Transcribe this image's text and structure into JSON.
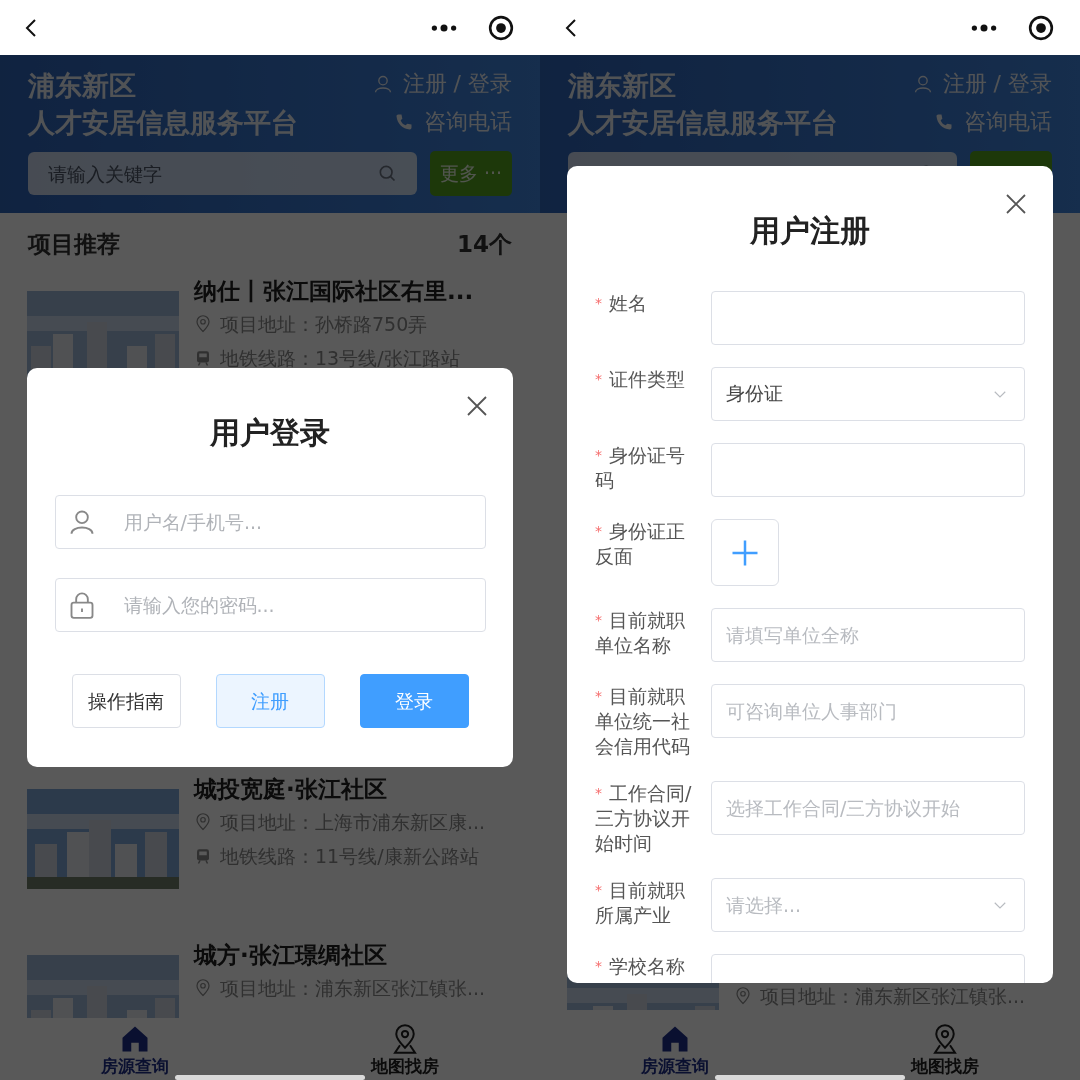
{
  "screens": [
    {
      "header": {
        "title": [
          "浦东新区",
          "人才安居信息服务平台"
        ],
        "account_link": "注册 / 登录",
        "hotline_link": "咨询电话",
        "search": {
          "placeholder": "请输入关键字"
        },
        "more_button": "更多 ···"
      },
      "section": {
        "title": "项目推荐",
        "count": "14个"
      },
      "projects": [
        {
          "title": "纳仕丨张江国际社区右里...",
          "address_label": "项目地址：",
          "address": "孙桥路750弄",
          "metro_label": "地铁线路：",
          "metro": "13号线/张江路站"
        },
        {
          "title": "城投宽庭·张江社区",
          "address_label": "项目地址：",
          "address": "上海市浦东新区康...",
          "metro_label": "地铁线路：",
          "metro": "11号线/康新公路站"
        },
        {
          "title": "城方·张江璟绸社区",
          "address_label": "项目地址：",
          "address": "浦东新区张江镇张..."
        }
      ],
      "tabs": [
        {
          "label": "房源查询",
          "selected": true
        },
        {
          "label": "地图找房",
          "selected": false
        }
      ],
      "dialog": {
        "kind": "login",
        "title": "用户登录",
        "username": {
          "placeholder": "用户名/手机号..."
        },
        "password": {
          "placeholder": "请输入您的密码..."
        },
        "buttons": [
          {
            "kind": "plain",
            "label": "操作指南"
          },
          {
            "kind": "secondary",
            "label": "注册"
          },
          {
            "kind": "primary",
            "label": "登录"
          }
        ]
      }
    },
    {
      "header": {
        "title": [
          "浦东新区",
          "人才安居信息服务平台"
        ],
        "account_link": "注册 / 登录",
        "hotline_link": "咨询电话"
      },
      "projects": [
        {
          "address_label": "项目地址：",
          "address": "浦东新区张江镇张..."
        }
      ],
      "tabs": [
        {
          "label": "房源查询",
          "selected": true
        },
        {
          "label": "地图找房",
          "selected": false
        }
      ],
      "dialog": {
        "kind": "register",
        "title": "用户注册",
        "fields": [
          {
            "kind": "text",
            "label": "姓名",
            "required_mark": "*"
          },
          {
            "kind": "select",
            "label": "证件类型",
            "required_mark": "*",
            "value": "身份证"
          },
          {
            "kind": "text",
            "label": "身份证号码",
            "required_mark": "*"
          },
          {
            "kind": "upload",
            "label": "身份证正反面",
            "required_mark": "*"
          },
          {
            "kind": "text",
            "label": "目前就职单位名称",
            "required_mark": "*",
            "placeholder": "请填写单位全称"
          },
          {
            "kind": "text",
            "label": "目前就职单位统一社会信用代码",
            "required_mark": "*",
            "placeholder": "可咨询单位人事部门"
          },
          {
            "kind": "text",
            "label": "工作合同/三方协议开始时间",
            "required_mark": "*",
            "placeholder": "选择工作合同/三方协议开始"
          },
          {
            "kind": "select",
            "label": "目前就职所属产业",
            "required_mark": "*",
            "placeholder": "请选择..."
          },
          {
            "kind": "text",
            "label": "学校名称",
            "required_mark": "*"
          }
        ]
      }
    }
  ]
}
